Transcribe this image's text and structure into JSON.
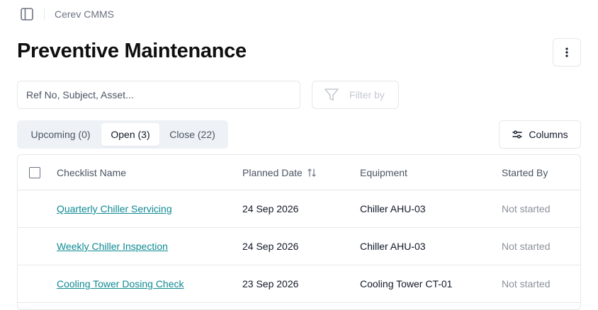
{
  "topbar": {
    "breadcrumb": "Cerev CMMS"
  },
  "page": {
    "title": "Preventive Maintenance"
  },
  "search": {
    "placeholder": "Ref No, Subject, Asset..."
  },
  "filter": {
    "label": "Filter by"
  },
  "tabs": [
    {
      "label": "Upcoming (0)",
      "active": false
    },
    {
      "label": "Open (3)",
      "active": true
    },
    {
      "label": "Close (22)",
      "active": false
    }
  ],
  "toolbar": {
    "columns_label": "Columns"
  },
  "table": {
    "headers": {
      "name": "Checklist Name",
      "planned_date": "Planned Date",
      "equipment": "Equipment",
      "started_by": "Started By"
    },
    "rows": [
      {
        "name": "Quarterly Chiller Servicing",
        "planned_date": "24 Sep 2026",
        "equipment": "Chiller AHU-03",
        "started_by": "Not started"
      },
      {
        "name": "Weekly Chiller Inspection",
        "planned_date": "24 Sep 2026",
        "equipment": "Chiller AHU-03",
        "started_by": "Not started"
      },
      {
        "name": "Cooling Tower Dosing Check",
        "planned_date": "23 Sep 2026",
        "equipment": "Cooling Tower CT-01",
        "started_by": "Not started"
      }
    ]
  },
  "colors": {
    "link": "#0e8a94",
    "tab_bg": "#eef2f6",
    "border": "#e5e7eb"
  }
}
